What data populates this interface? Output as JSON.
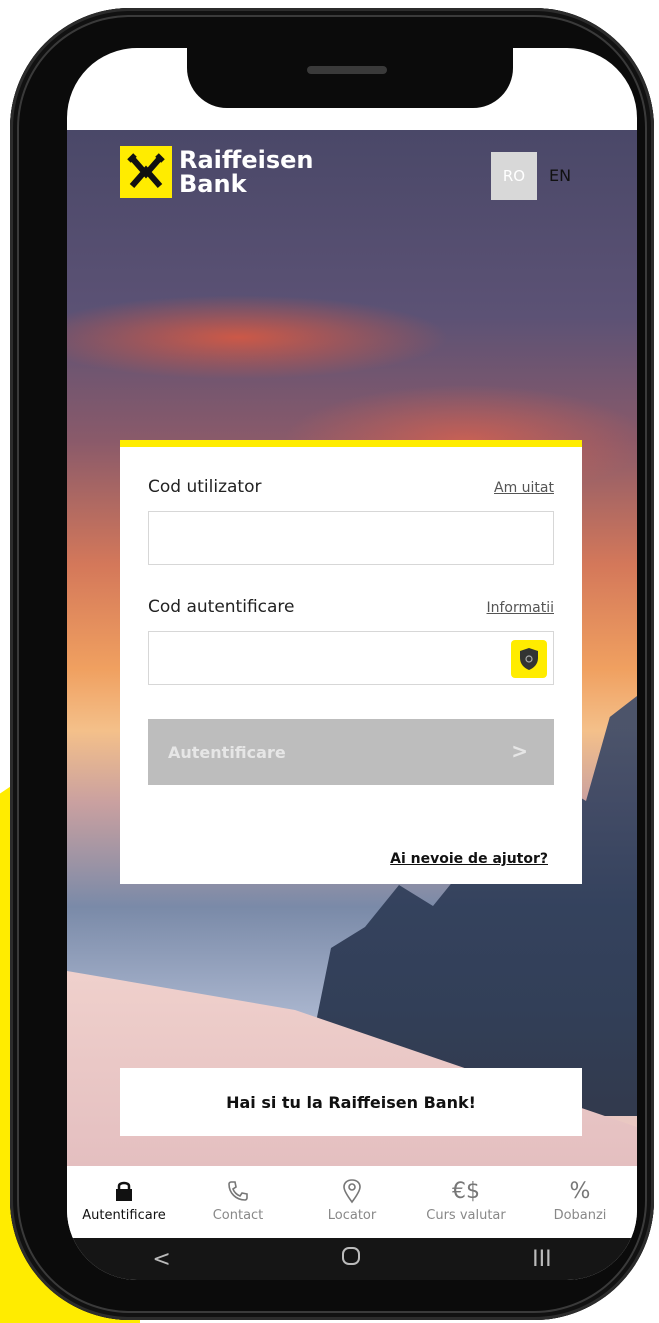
{
  "brand": {
    "line1": "Raiffeisen",
    "line2": "Bank",
    "color": "#ffec00"
  },
  "language": {
    "ro": "RO",
    "en": "EN"
  },
  "login": {
    "user_label": "Cod utilizator",
    "forgot_link": "Am uitat",
    "auth_label": "Cod autentificare",
    "info_link": "Informatii",
    "submit_label": "Autentificare",
    "help_link": "Ai nevoie de ajutor?"
  },
  "promo": {
    "label": "Hai si tu la Raiffeisen Bank!"
  },
  "nav": [
    {
      "icon": "lock-icon",
      "label": "Autentificare"
    },
    {
      "icon": "phone-icon",
      "label": "Contact"
    },
    {
      "icon": "location-pin-icon",
      "label": "Locator"
    },
    {
      "icon": "currency-icon",
      "symbol": "€$",
      "label": "Curs valutar"
    },
    {
      "icon": "percent-icon",
      "symbol": "%",
      "label": "Dobanzi"
    }
  ],
  "system_nav": [
    {
      "icon": "back-icon",
      "symbol": "<"
    },
    {
      "icon": "home-icon"
    },
    {
      "icon": "recents-icon",
      "symbol": "III"
    }
  ]
}
